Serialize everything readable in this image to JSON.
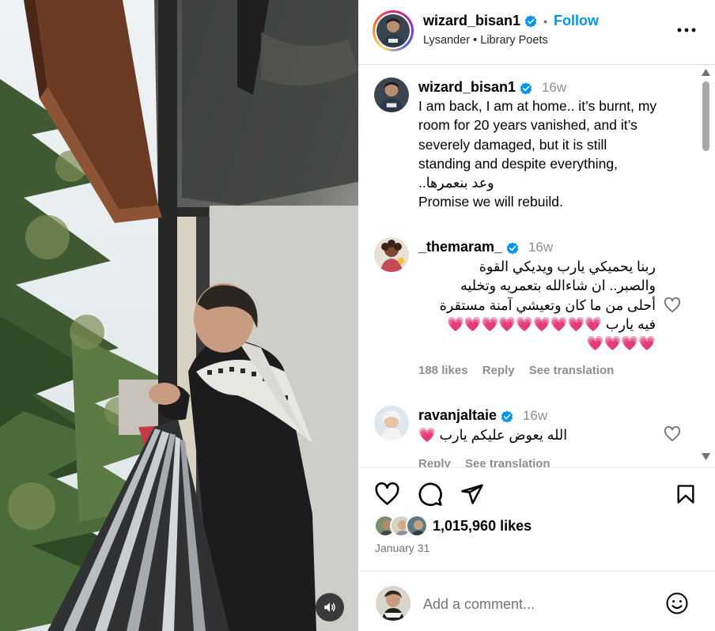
{
  "post": {
    "author": "wizard_bisan1",
    "follow_label": "Follow",
    "separator": "•",
    "audio_line": [
      "Lysander",
      "Library Poets"
    ]
  },
  "caption": {
    "username": "wizard_bisan1",
    "time": "16w",
    "lines": [
      "I am back, I am at home.. it’s burnt, my",
      "room for 20 years vanished, and it’s",
      "severely damaged, but it is still",
      "standing and despite everything,",
      "وعد بنعمرها..",
      "Promise we will rebuild."
    ]
  },
  "comments": [
    {
      "username": "_themaram_",
      "time": "16w",
      "lines": [
        "ربنا يحميكي يارب ويديكي القوة",
        "والصبر.. ان شاءالله بتعمريه وتخليه",
        "أحلى من ما كان وتعيشي آمنة مستقرة",
        "فيه يارب 💗💗💗💗💗💗💗💗💗",
        "💗💗💗💗"
      ],
      "likes": "188 likes",
      "reply": "Reply",
      "translate": "See translation"
    },
    {
      "username": "ravanjaltaie",
      "time": "16w",
      "lines": [
        "الله يعوض عليكم يارب 💗"
      ],
      "reply": "Reply",
      "translate": "See translation"
    }
  ],
  "engagement": {
    "likes": "1,015,960 likes",
    "date": "January 31"
  },
  "composer": {
    "placeholder": "Add a comment..."
  },
  "icons": {
    "more": "more-options-icon",
    "like": "heart-icon",
    "comment": "comment-bubble-icon",
    "share": "paper-plane-icon",
    "save": "bookmark-icon",
    "audio": "speaker-icon",
    "emoji": "smiley-icon",
    "verified": "verified-badge-icon"
  },
  "colors": {
    "accent": "#0095f6",
    "verified": "#0095f6",
    "muted": "#8e8e8e",
    "heart_emoji": "#e8375f"
  }
}
